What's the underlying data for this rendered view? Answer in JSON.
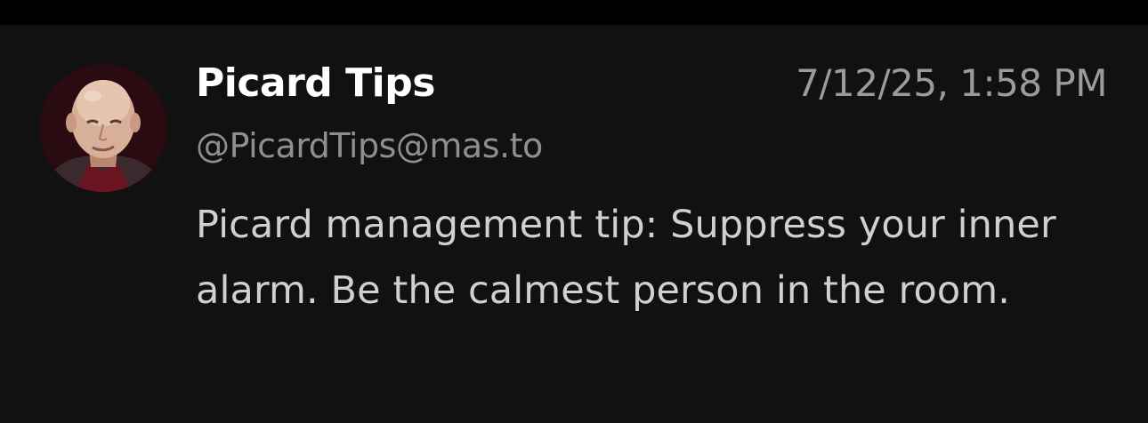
{
  "post": {
    "display_name": "Picard Tips",
    "handle": "@PicardTips@mas.to",
    "timestamp": "7/12/25, 1:58 PM",
    "content": "Picard management tip: Suppress your inner alarm. Be the calmest person in the room."
  },
  "colors": {
    "background": "#111111",
    "top_bar": "#000000",
    "name": "#ffffff",
    "meta": "#9a9a9f",
    "body_text": "#d0d0d4"
  }
}
